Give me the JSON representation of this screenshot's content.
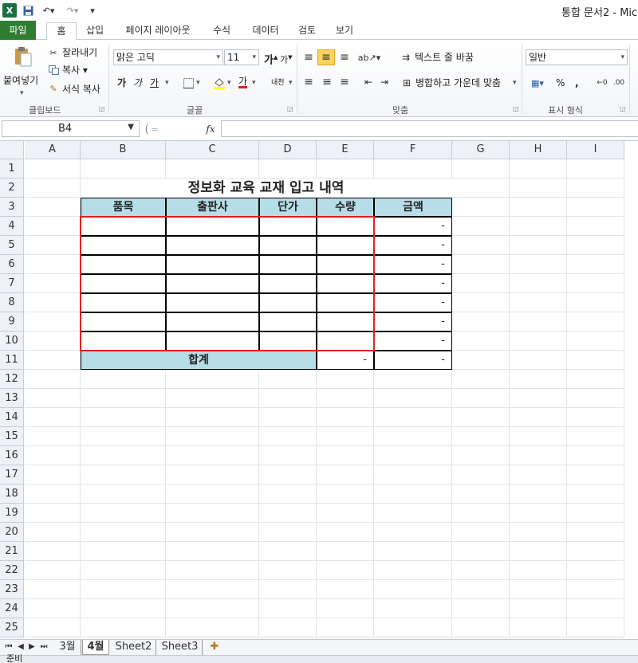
{
  "titlebar": {
    "app_icon": "excel-icon",
    "title": "통합 문서2 - Mic",
    "qat": [
      "save-icon",
      "undo-icon",
      "redo-icon",
      "customize-qat-icon"
    ]
  },
  "ribbon_tabs": [
    "파일",
    "홈",
    "삽입",
    "페이지 레이아웃",
    "수식",
    "데이터",
    "검토",
    "보기"
  ],
  "ribbon": {
    "clipboard": {
      "paste": "붙여넣기",
      "cut": "잘라내기",
      "copy": "복사 ▾",
      "format_painter": "서식 복사",
      "group_label": "클립보드"
    },
    "font": {
      "font_name": "맑은 고딕",
      "font_size": "11",
      "grow": "가",
      "shrink": "가",
      "bold": "가",
      "italic": "가",
      "underline": "가",
      "phonetic": "내천",
      "font_color_letter": "가",
      "group_label": "글꼴"
    },
    "alignment": {
      "wrap_text": "텍스트 줄 바꿈",
      "merge_center": "병합하고 가운데 맞춤",
      "group_label": "맞춤"
    },
    "number": {
      "format": "일반",
      "percent": "%",
      "comma": ",",
      "group_label": "표시 형식"
    }
  },
  "formula_bar": {
    "name_box": "B4",
    "fx": "fx",
    "formula": ""
  },
  "grid": {
    "columns": [
      "A",
      "B",
      "C",
      "D",
      "E",
      "F",
      "G",
      "H",
      "I"
    ],
    "rows": [
      "1",
      "2",
      "3",
      "4",
      "5",
      "6",
      "7",
      "8",
      "9",
      "10",
      "11",
      "12",
      "13",
      "14",
      "15",
      "16",
      "17",
      "18",
      "19",
      "20",
      "21",
      "22",
      "23",
      "24",
      "25"
    ]
  },
  "table": {
    "title": "정보화 교육 교재 입고 내역",
    "headers": [
      "품목",
      "출판사",
      "단가",
      "수량",
      "금액"
    ],
    "amount_column": [
      "-",
      "-",
      "-",
      "-",
      "-",
      "-",
      "-"
    ],
    "total_label": "합계",
    "total_qty": "-",
    "total_amount": "-",
    "selection_color": "#e02020",
    "header_fill": "#b7dde8"
  },
  "sheet_tabs": [
    "3월",
    "4월",
    "Sheet2",
    "Sheet3"
  ],
  "active_sheet": "4월",
  "status": {
    "text": "준비"
  }
}
